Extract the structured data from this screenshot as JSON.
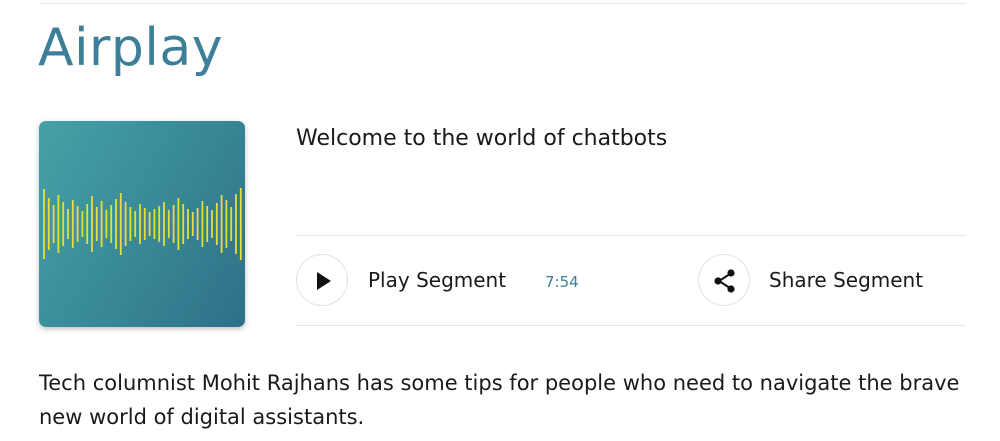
{
  "section": {
    "title": "Airplay"
  },
  "segment": {
    "title": "Welcome to the world of chatbots",
    "artwork_icon": "audio-waveform-icon",
    "play_label": "Play Segment",
    "play_icon": "play-icon",
    "duration": "7:54",
    "share_label": "Share Segment",
    "share_icon": "share-icon",
    "description": "Tech columnist Mohit Rajhans has some tips for people who need to navigate the brave new world of digital assistants."
  },
  "colors": {
    "accent": "#3d7f99",
    "waveform": "#e6dd3b",
    "artwork_start": "#46a1a7",
    "artwork_end": "#2f7086"
  }
}
